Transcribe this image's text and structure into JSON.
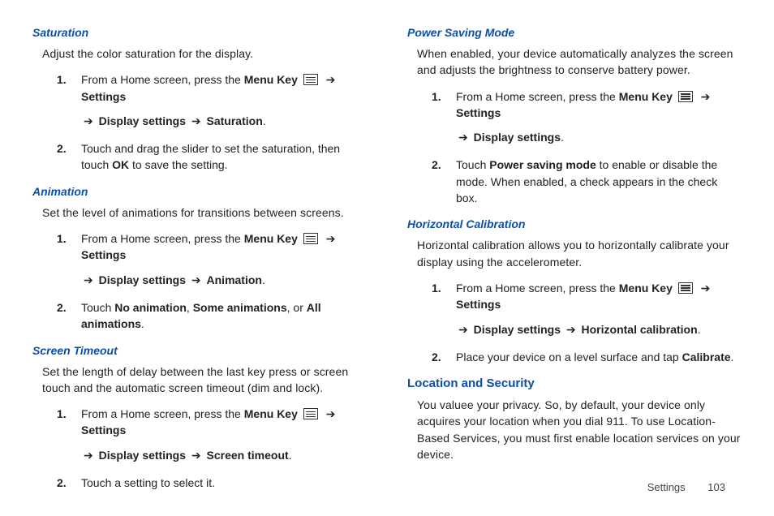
{
  "left": {
    "saturation": {
      "title": "Saturation",
      "intro": "Adjust the color saturation for the display.",
      "step1_pre": "From a Home screen, press the ",
      "menu_key": "Menu Key",
      "settings": "Settings",
      "display_settings": "Display settings",
      "target": "Saturation",
      "step2_a": "Touch and drag the slider to set the saturation, then touch ",
      "ok": "OK",
      "step2_b": " to save the setting."
    },
    "animation": {
      "title": "Animation",
      "intro": "Set the level of animations for transitions between screens.",
      "step1_pre": "From a Home screen, press the ",
      "menu_key": "Menu Key",
      "settings": "Settings",
      "display_settings": "Display settings",
      "target": "Animation",
      "step2_a": "Touch ",
      "no_anim": "No animation",
      "sep1": ", ",
      "some_anim": "Some animations",
      "sep2": ", or ",
      "all_anim": "All animations",
      "period": "."
    },
    "timeout": {
      "title": "Screen Timeout",
      "intro": "Set the length of delay between the last key press or screen touch and the automatic screen timeout (dim and lock).",
      "step1_pre": "From a Home screen, press the ",
      "menu_key": "Menu Key",
      "settings": "Settings",
      "display_settings": "Display settings",
      "target": "Screen timeout",
      "step2": "Touch a setting to select it."
    }
  },
  "right": {
    "power": {
      "title": "Power Saving Mode",
      "intro": "When enabled, your device automatically analyzes the screen and adjusts the brightness to conserve battery power.",
      "step1_pre": "From a Home screen, press the ",
      "menu_key": "Menu Key",
      "settings": "Settings",
      "display_settings": "Display settings",
      "step2_a": "Touch ",
      "psm": "Power saving mode",
      "step2_b": " to enable or disable the mode. When enabled, a check appears in the check box."
    },
    "horiz": {
      "title": "Horizontal Calibration",
      "intro": "Horizontal calibration allows you to horizontally calibrate your display using the accelerometer.",
      "step1_pre": "From a Home screen, press the ",
      "menu_key": "Menu Key",
      "settings": "Settings",
      "display_settings": "Display settings",
      "target": "Horizontal calibration",
      "step2_a": "Place your device on a level surface and tap ",
      "calibrate": "Calibrate",
      "period": "."
    },
    "location": {
      "title": "Location and Security",
      "intro": "You valuee your privacy. So, by default, your device only acquires your location when you dial 911. To use Location-Based Services, you must first enable location services on your device."
    }
  },
  "arrow": "➔",
  "footer": {
    "section": "Settings",
    "page": "103"
  }
}
